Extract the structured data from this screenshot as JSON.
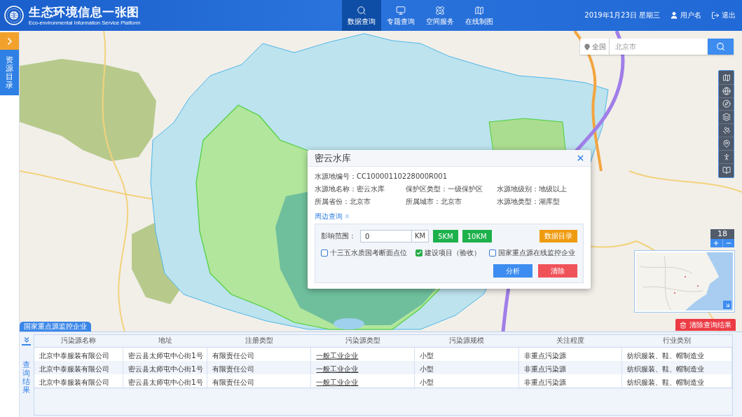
{
  "header": {
    "title": "生态环境信息一张图",
    "subtitle": "Eco-environmental Information Service Platform",
    "nav": [
      {
        "label": "数据查询",
        "kind": "data",
        "selected": true
      },
      {
        "label": "专题查询",
        "kind": "topic",
        "selected": false
      },
      {
        "label": "空间服务",
        "kind": "space",
        "selected": false
      },
      {
        "label": "在线制图",
        "kind": "mapping",
        "selected": false
      }
    ],
    "date": "2019年1月23日 星期三",
    "user": "用户名",
    "logout": "退出"
  },
  "sidebar": {
    "catalog_tab": "资源目录"
  },
  "search": {
    "scope": "全国",
    "placeholder": "北京市"
  },
  "map_zoom": {
    "value": "18"
  },
  "popup": {
    "title": "密云水库",
    "code": "水源地编号：CC10000110228000R001",
    "fields": [
      "水源地名称：密云水库",
      "保护区类型：一级保护区",
      "水源地级别：地级以上",
      "所属省份：北京市",
      "所属城市：北京市",
      "水源地类型：湖库型"
    ],
    "nearby": {
      "link": "周边查询",
      "expanded": true,
      "range_label": "影响范围：",
      "range_value": "0",
      "unit": "KM",
      "presets": [
        "5KM",
        "10KM"
      ],
      "catalog_button": "数据目录",
      "layers": [
        {
          "label": "十三五水质国考断面点位",
          "checked": false
        },
        {
          "label": "建设项目（验收）",
          "checked": true
        },
        {
          "label": "国家重点源在线监控企业",
          "checked": false
        }
      ],
      "actions": [
        {
          "label": "分析",
          "kind": "primary"
        },
        {
          "label": "清除",
          "kind": "danger"
        }
      ]
    }
  },
  "results": {
    "tab": "国家重点源监控企业",
    "clear_button": "清除查询结果",
    "side_label": "查询结果",
    "columns": [
      {
        "label": "污染源名称",
        "kind": "text"
      },
      {
        "label": "地址",
        "kind": "text"
      },
      {
        "label": "注册类型",
        "kind": "text"
      },
      {
        "label": "污染源类型",
        "kind": "link"
      },
      {
        "label": "污染源规模",
        "kind": "text"
      },
      {
        "label": "关注程度",
        "kind": "text"
      },
      {
        "label": "行业类别",
        "kind": "text"
      }
    ],
    "rows": [
      [
        "北京中泰服装有限公司",
        "密云县太师屯中心街1号",
        "有限责任公司",
        "一般工业企业",
        "小型",
        "非重点污染源",
        "纺织服装、鞋、帽制造业"
      ],
      [
        "北京中泰服装有限公司",
        "密云县太师屯中心街1号",
        "有限责任公司",
        "一般工业企业",
        "小型",
        "非重点污染源",
        "纺织服装、鞋、帽制造业"
      ],
      [
        "北京中泰服装有限公司",
        "密云县太师屯中心街1号",
        "有限责任公司",
        "一般工业企业",
        "小型",
        "非重点污染源",
        "纺织服装、鞋、帽制造业"
      ]
    ]
  }
}
